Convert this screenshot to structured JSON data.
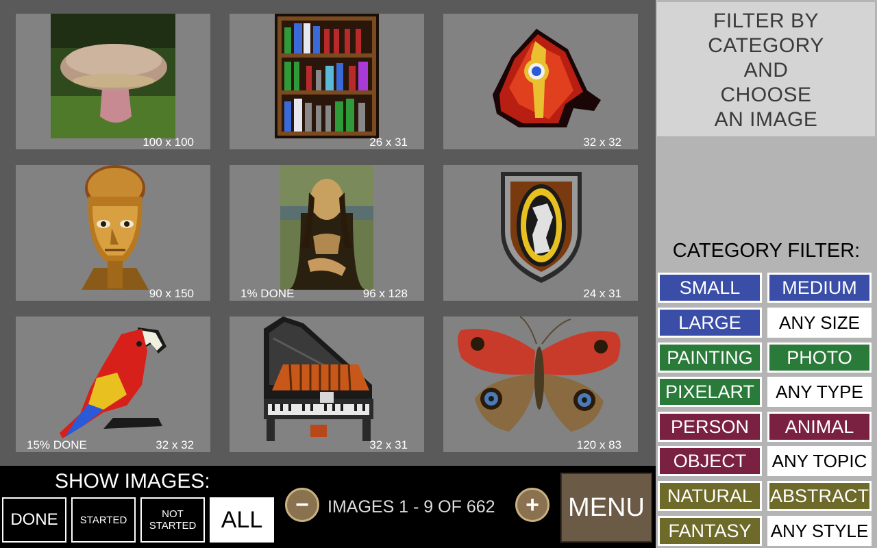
{
  "tiles": [
    {
      "dims": "100 x 100",
      "progress": "",
      "art": "mushroom"
    },
    {
      "dims": "26 x 31",
      "progress": "",
      "art": "bookshelf"
    },
    {
      "dims": "32 x 32",
      "progress": "",
      "art": "helmet"
    },
    {
      "dims": "90 x 150",
      "progress": "",
      "art": "golden-head"
    },
    {
      "dims": "96 x 128",
      "progress": "1% DONE",
      "art": "mona-lisa"
    },
    {
      "dims": "24 x 31",
      "progress": "",
      "art": "shield"
    },
    {
      "dims": "32 x 32",
      "progress": "15% DONE",
      "art": "parrot"
    },
    {
      "dims": "32 x 31",
      "progress": "",
      "art": "grand-piano"
    },
    {
      "dims": "120 x 83",
      "progress": "",
      "art": "butterfly"
    }
  ],
  "panel": {
    "title_lines": [
      "FILTER BY",
      "CATEGORY",
      "AND",
      "CHOOSE",
      "AN IMAGE"
    ],
    "category_label": "CATEGORY FILTER:"
  },
  "filters": [
    {
      "label": "SMALL",
      "color": "#3a4ea8"
    },
    {
      "label": "MEDIUM",
      "color": "#3a4ea8"
    },
    {
      "label": "LARGE",
      "color": "#3a4ea8"
    },
    {
      "label": "ANY SIZE",
      "color": "#ffffff"
    },
    {
      "label": "PAINTING",
      "color": "#2a7a3a"
    },
    {
      "label": "PHOTO",
      "color": "#2a7a3a"
    },
    {
      "label": "PIXELART",
      "color": "#2a7a3a"
    },
    {
      "label": "ANY TYPE",
      "color": "#ffffff"
    },
    {
      "label": "PERSON",
      "color": "#7a2040"
    },
    {
      "label": "ANIMAL",
      "color": "#7a2040"
    },
    {
      "label": "OBJECT",
      "color": "#7a2040"
    },
    {
      "label": "ANY TOPIC",
      "color": "#ffffff"
    },
    {
      "label": "NATURAL",
      "color": "#6e6a2a"
    },
    {
      "label": "ABSTRACT",
      "color": "#6e6a2a"
    },
    {
      "label": "FANTASY",
      "color": "#6e6a2a"
    },
    {
      "label": "ANY STYLE",
      "color": "#ffffff"
    }
  ],
  "bottom": {
    "show_label": "SHOW IMAGES:",
    "buttons": {
      "done": "DONE",
      "started": "STARTED",
      "not_started_1": "NOT",
      "not_started_2": "STARTED",
      "all": "ALL"
    },
    "prev_icon": "minus-icon",
    "next_icon": "plus-icon",
    "count": "IMAGES 1 - 9  OF  662",
    "menu": "MENU"
  }
}
